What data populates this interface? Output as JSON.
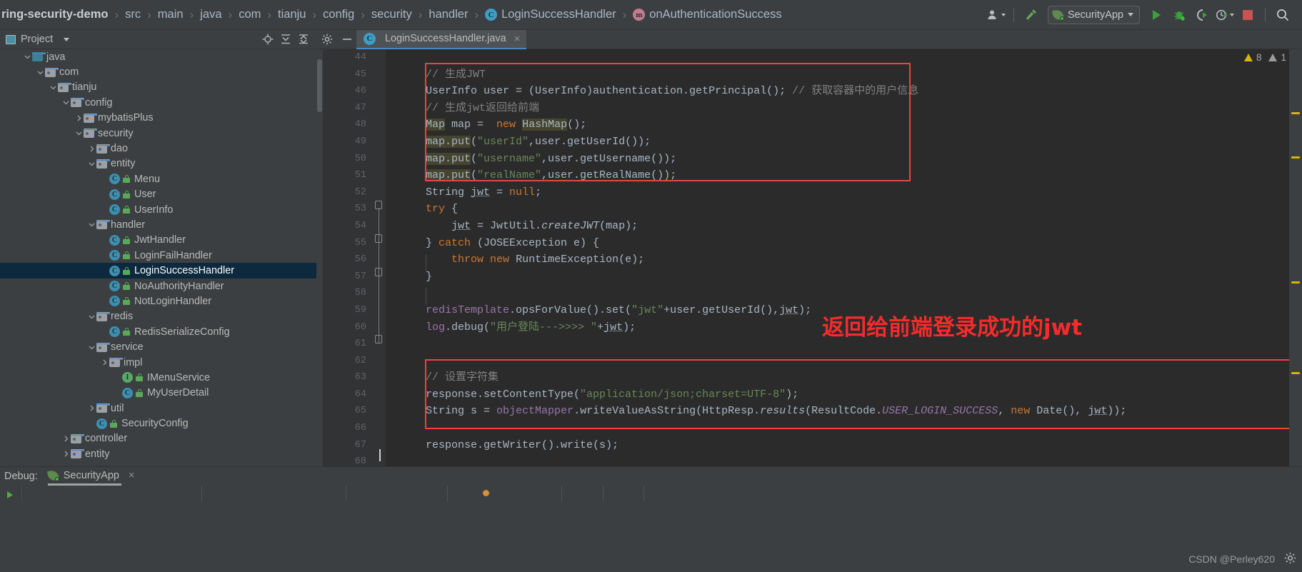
{
  "topbar": {
    "breadcrumb": [
      {
        "label": "ring-security-demo",
        "icon": null
      },
      {
        "label": "src",
        "icon": null
      },
      {
        "label": "main",
        "icon": null
      },
      {
        "label": "java",
        "icon": null
      },
      {
        "label": "com",
        "icon": null
      },
      {
        "label": "tianju",
        "icon": null
      },
      {
        "label": "config",
        "icon": null
      },
      {
        "label": "security",
        "icon": null
      },
      {
        "label": "handler",
        "icon": null
      },
      {
        "label": "LoginSuccessHandler",
        "icon": "class-icon"
      },
      {
        "label": "onAuthenticationSuccess",
        "icon": "method-icon"
      }
    ],
    "run_config": "SecurityApp",
    "buttons": {
      "user_avatar": "user-avatar-icon",
      "build": "hammer-icon",
      "run": "run-icon",
      "debug": "debug-icon",
      "run_coverage": "run-with-coverage-icon",
      "profiler": "profiler-icon",
      "stop": "stop-icon",
      "search": "search-everywhere-icon"
    }
  },
  "project_panel": {
    "title": "Project",
    "actions": [
      "locate-icon",
      "expand-all-icon",
      "collapse-all-icon",
      "settings-icon",
      "hide-icon"
    ],
    "tree": [
      {
        "label": "java",
        "depth": 3,
        "arrow": "down",
        "kind": "folder-src"
      },
      {
        "label": "com",
        "depth": 4,
        "arrow": "down",
        "kind": "folder-pkg"
      },
      {
        "label": "tianju",
        "depth": 5,
        "arrow": "down",
        "kind": "folder-pkg"
      },
      {
        "label": "config",
        "depth": 6,
        "arrow": "down",
        "kind": "folder-pkg"
      },
      {
        "label": "mybatisPlus",
        "depth": 7,
        "arrow": "right",
        "kind": "folder-pkg"
      },
      {
        "label": "security",
        "depth": 7,
        "arrow": "down",
        "kind": "folder-pkg"
      },
      {
        "label": "dao",
        "depth": 8,
        "arrow": "right",
        "kind": "folder-pkg"
      },
      {
        "label": "entity",
        "depth": 8,
        "arrow": "down",
        "kind": "folder-pkg"
      },
      {
        "label": "Menu",
        "depth": 9,
        "arrow": "none",
        "kind": "class"
      },
      {
        "label": "User",
        "depth": 9,
        "arrow": "none",
        "kind": "class"
      },
      {
        "label": "UserInfo",
        "depth": 9,
        "arrow": "none",
        "kind": "class"
      },
      {
        "label": "handler",
        "depth": 8,
        "arrow": "down",
        "kind": "folder-pkg"
      },
      {
        "label": "JwtHandler",
        "depth": 9,
        "arrow": "none",
        "kind": "class"
      },
      {
        "label": "LoginFailHandler",
        "depth": 9,
        "arrow": "none",
        "kind": "class"
      },
      {
        "label": "LoginSuccessHandler",
        "depth": 9,
        "arrow": "none",
        "kind": "class",
        "selected": true
      },
      {
        "label": "NoAuthorityHandler",
        "depth": 9,
        "arrow": "none",
        "kind": "class"
      },
      {
        "label": "NotLoginHandler",
        "depth": 9,
        "arrow": "none",
        "kind": "class"
      },
      {
        "label": "redis",
        "depth": 8,
        "arrow": "down",
        "kind": "folder-pkg"
      },
      {
        "label": "RedisSerializeConfig",
        "depth": 9,
        "arrow": "none",
        "kind": "class"
      },
      {
        "label": "service",
        "depth": 8,
        "arrow": "down",
        "kind": "folder-pkg"
      },
      {
        "label": "impl",
        "depth": 9,
        "arrow": "right",
        "kind": "folder-pkg"
      },
      {
        "label": "IMenuService",
        "depth": 10,
        "arrow": "none",
        "kind": "interface"
      },
      {
        "label": "MyUserDetail",
        "depth": 10,
        "arrow": "none",
        "kind": "class"
      },
      {
        "label": "util",
        "depth": 8,
        "arrow": "right",
        "kind": "folder-pkg"
      },
      {
        "label": "SecurityConfig",
        "depth": 8,
        "arrow": "none",
        "kind": "class"
      },
      {
        "label": "controller",
        "depth": 6,
        "arrow": "right",
        "kind": "folder-pkg"
      },
      {
        "label": "entity",
        "depth": 6,
        "arrow": "right",
        "kind": "folder-pkg"
      }
    ]
  },
  "editor": {
    "tab": {
      "label": "LoginSuccessHandler.java",
      "icon": "class-icon",
      "close": "×"
    },
    "inspection": {
      "warning_count": "8",
      "weak_count": "1"
    },
    "first_line_number": 44,
    "line_numbers": [
      44,
      45,
      46,
      47,
      48,
      49,
      50,
      51,
      52,
      53,
      54,
      55,
      56,
      57,
      58,
      59,
      60,
      61,
      62,
      63,
      64,
      65,
      66,
      67,
      68
    ],
    "lines": [
      {
        "n": 44,
        "tokens": []
      },
      {
        "n": 45,
        "tokens": [
          {
            "t": "// 生成JWT",
            "c": "cm"
          }
        ]
      },
      {
        "n": 46,
        "tokens": [
          {
            "t": "UserInfo user = (UserInfo)authentication.getPrincipal();",
            "c": "n"
          },
          {
            "t": " // 获取容器中的用户信息",
            "c": "cm"
          }
        ]
      },
      {
        "n": 47,
        "tokens": [
          {
            "t": "// 生成jwt返回给前端",
            "c": "cm"
          }
        ]
      },
      {
        "n": 48,
        "tokens": [
          {
            "t": "Map",
            "c": "n hl"
          },
          {
            "t": " map =  ",
            "c": "n"
          },
          {
            "t": "new",
            "c": "k"
          },
          {
            "t": " ",
            "c": "n"
          },
          {
            "t": "HashMap",
            "c": "n hl"
          },
          {
            "t": "();",
            "c": "n"
          }
        ]
      },
      {
        "n": 49,
        "tokens": [
          {
            "t": "map.put",
            "c": "n hl"
          },
          {
            "t": "(",
            "c": "n"
          },
          {
            "t": "\"userId\"",
            "c": "s"
          },
          {
            "t": ",user.getUserId());",
            "c": "n"
          }
        ]
      },
      {
        "n": 50,
        "tokens": [
          {
            "t": "map.put",
            "c": "n hl"
          },
          {
            "t": "(",
            "c": "n"
          },
          {
            "t": "\"username\"",
            "c": "s"
          },
          {
            "t": ",user.getUsername());",
            "c": "n"
          }
        ]
      },
      {
        "n": 51,
        "tokens": [
          {
            "t": "map.put",
            "c": "n hl"
          },
          {
            "t": "(",
            "c": "n"
          },
          {
            "t": "\"realName\"",
            "c": "s"
          },
          {
            "t": ",user.getRealName());",
            "c": "n"
          }
        ]
      },
      {
        "n": 52,
        "tokens": [
          {
            "t": "String ",
            "c": "n"
          },
          {
            "t": "jwt",
            "c": "n und"
          },
          {
            "t": " = ",
            "c": "n"
          },
          {
            "t": "null",
            "c": "k"
          },
          {
            "t": ";",
            "c": "n"
          }
        ]
      },
      {
        "n": 53,
        "tokens": [
          {
            "t": "try",
            "c": "k"
          },
          {
            "t": " {",
            "c": "n"
          }
        ]
      },
      {
        "n": 54,
        "tokens": [
          {
            "t": "    ",
            "c": "n"
          },
          {
            "t": "jwt",
            "c": "n und"
          },
          {
            "t": " = JwtUtil.",
            "c": "n"
          },
          {
            "t": "createJWT",
            "c": "ita"
          },
          {
            "t": "(map);",
            "c": "n"
          }
        ]
      },
      {
        "n": 55,
        "tokens": [
          {
            "t": "} ",
            "c": "n"
          },
          {
            "t": "catch",
            "c": "k"
          },
          {
            "t": " (JOSEException e) {",
            "c": "n"
          }
        ]
      },
      {
        "n": 56,
        "tokens": [
          {
            "t": "    ",
            "c": "n"
          },
          {
            "t": "throw",
            "c": "k"
          },
          {
            "t": " ",
            "c": "n"
          },
          {
            "t": "new",
            "c": "k"
          },
          {
            "t": " RuntimeException(e);",
            "c": "n"
          }
        ]
      },
      {
        "n": 57,
        "tokens": [
          {
            "t": "}",
            "c": "n"
          }
        ]
      },
      {
        "n": 58,
        "tokens": []
      },
      {
        "n": 59,
        "tokens": [
          {
            "t": "redisTemplate",
            "c": "fld"
          },
          {
            "t": ".opsForValue().set(",
            "c": "n"
          },
          {
            "t": "\"jwt\"",
            "c": "s"
          },
          {
            "t": "+user.getUserId(),",
            "c": "n"
          },
          {
            "t": "jwt",
            "c": "n und"
          },
          {
            "t": ");",
            "c": "n"
          }
        ]
      },
      {
        "n": 60,
        "tokens": [
          {
            "t": "log",
            "c": "fld"
          },
          {
            "t": ".debug(",
            "c": "n"
          },
          {
            "t": "\"用户登陆--->>>> \"",
            "c": "s"
          },
          {
            "t": "+",
            "c": "n"
          },
          {
            "t": "jwt",
            "c": "n und"
          },
          {
            "t": ");",
            "c": "n"
          }
        ]
      },
      {
        "n": 61,
        "tokens": []
      },
      {
        "n": 62,
        "tokens": []
      },
      {
        "n": 63,
        "tokens": [
          {
            "t": "// 设置字符集",
            "c": "cm"
          }
        ]
      },
      {
        "n": 64,
        "tokens": [
          {
            "t": "response.setContentType(",
            "c": "n"
          },
          {
            "t": "\"application/json;charset=UTF-8\"",
            "c": "s"
          },
          {
            "t": ");",
            "c": "n"
          }
        ]
      },
      {
        "n": 65,
        "tokens": [
          {
            "t": "String s = ",
            "c": "n"
          },
          {
            "t": "objectMapper",
            "c": "fld"
          },
          {
            "t": ".writeValueAsString(HttpResp.",
            "c": "n"
          },
          {
            "t": "results",
            "c": "ita"
          },
          {
            "t": "(ResultCode.",
            "c": "n"
          },
          {
            "t": "USER_LOGIN_SUCCESS",
            "c": "sfld"
          },
          {
            "t": ", ",
            "c": "n"
          },
          {
            "t": "new",
            "c": "k"
          },
          {
            "t": " Date(), ",
            "c": "n"
          },
          {
            "t": "jwt",
            "c": "n und"
          },
          {
            "t": "));",
            "c": "n"
          }
        ]
      },
      {
        "n": 66,
        "tokens": []
      },
      {
        "n": 67,
        "tokens": [
          {
            "t": "response.getWriter().write(s);",
            "c": "n"
          }
        ]
      },
      {
        "n": 68,
        "tokens": []
      }
    ],
    "annotations": [
      {
        "text": "返回给前端登录成功的jwt",
        "color": "#f62b2b"
      }
    ],
    "highlight_boxes": [
      {
        "name": "jwt-generation-box"
      },
      {
        "name": "charset-response-box"
      }
    ]
  },
  "statusbar": {
    "debug_label": "Debug:",
    "debug_tab": "SecurityApp",
    "close": "×",
    "watermark": "CSDN @Perley620",
    "settings_icon": "gear-icon"
  },
  "colors": {
    "accent": "#4a88c7",
    "selection": "#0d293e",
    "annotation_red": "#f62b2b",
    "editor_bg": "#2b2b2b",
    "panel_bg": "#3c3f41"
  }
}
